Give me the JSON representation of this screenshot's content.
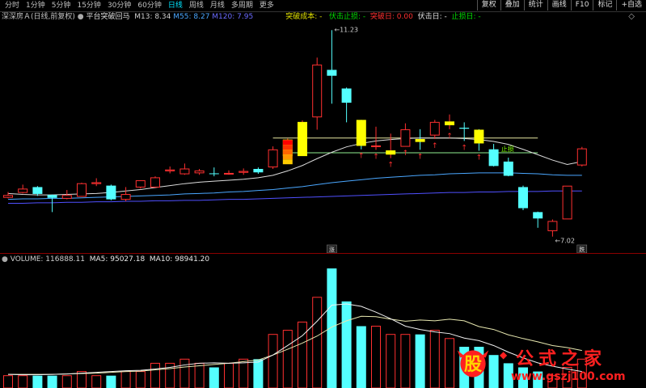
{
  "toolbar": {
    "tabs": [
      "分时",
      "1分钟",
      "5分钟",
      "15分钟",
      "30分钟",
      "60分钟",
      "日线",
      "周线",
      "月线",
      "多周期",
      "更多"
    ],
    "active_tab": 6,
    "right_buttons": [
      "复权",
      "叠加",
      "统计",
      "画线",
      "F10",
      "标记",
      "+自选"
    ]
  },
  "info": {
    "stock": "深深房Ａ(日线,前复权)",
    "indicator": "平台突破回马",
    "m13": "M13: 8.34",
    "m55": "M55: 8.27",
    "m120": "M120: 7.95",
    "breakout_cost": "突破成本: -",
    "ambush_stop": "伏击止损: -",
    "breakout_day": "突破日: 0.00",
    "ambush_day": "伏击日: -",
    "stop_day": "止损日: -",
    "close_symbol": "◇"
  },
  "annotations": {
    "high_label": "←11.23",
    "low_label": "←7.02",
    "stop_label": "止损",
    "marker_up": "涨",
    "marker_down": "跌"
  },
  "volume": {
    "label": "VOLUME: 116888.11",
    "ma5": "MA5: 95027.18",
    "ma10": "MA10: 98941.20"
  },
  "watermark": {
    "logo_char": "股",
    "title": "公式之家",
    "url": "www.gszj100.com"
  },
  "colors": {
    "up": "#ff3030",
    "down": "#54ffff",
    "ma13": "#dcdcdc",
    "ma55": "#4aa7ff",
    "ma120": "#5050ff",
    "platform": "#e6e6a0",
    "support": "#90ee90",
    "highlight": "#ffff00"
  },
  "chart_data": {
    "type": "candlestick",
    "candles": [
      {
        "o": 7.82,
        "c": 7.86,
        "h": 7.93,
        "l": 7.8
      },
      {
        "o": 7.92,
        "c": 7.99,
        "h": 8.08,
        "l": 7.9
      },
      {
        "o": 8.03,
        "c": 7.89,
        "h": 8.05,
        "l": 7.85
      },
      {
        "o": 7.87,
        "c": 7.81,
        "h": 7.88,
        "l": 7.52
      },
      {
        "o": 7.8,
        "c": 7.86,
        "h": 7.97,
        "l": 7.78
      },
      {
        "o": 7.84,
        "c": 8.1,
        "h": 8.12,
        "l": 7.84
      },
      {
        "o": 8.1,
        "c": 8.12,
        "h": 8.21,
        "l": 8.05
      },
      {
        "o": 8.06,
        "c": 7.78,
        "h": 8.08,
        "l": 7.76
      },
      {
        "o": 7.78,
        "c": 7.88,
        "h": 8.03,
        "l": 7.74
      },
      {
        "o": 8.03,
        "c": 8.16,
        "h": 8.16,
        "l": 8.0
      },
      {
        "o": 8.03,
        "c": 8.22,
        "h": 8.25,
        "l": 8.02
      },
      {
        "o": 8.36,
        "c": 8.38,
        "h": 8.45,
        "l": 8.31
      },
      {
        "o": 8.3,
        "c": 8.4,
        "h": 8.51,
        "l": 8.28
      },
      {
        "o": 8.32,
        "c": 8.36,
        "h": 8.4,
        "l": 8.28
      },
      {
        "o": 8.31,
        "c": 8.3,
        "h": 8.43,
        "l": 8.25
      },
      {
        "o": 8.3,
        "c": 8.31,
        "h": 8.37,
        "l": 8.28
      },
      {
        "o": 8.33,
        "c": 8.35,
        "h": 8.41,
        "l": 8.28
      },
      {
        "o": 8.4,
        "c": 8.33,
        "h": 8.43,
        "l": 8.3
      },
      {
        "o": 8.44,
        "c": 8.79,
        "h": 8.86,
        "l": 8.4
      },
      {
        "o": 8.67,
        "c": 8.99,
        "h": 9.02,
        "l": 8.67
      },
      {
        "o": 8.67,
        "c": 9.35,
        "h": 9.39,
        "l": 8.67
      },
      {
        "o": 9.46,
        "c": 10.52,
        "h": 10.67,
        "l": 9.2
      },
      {
        "o": 10.42,
        "c": 10.3,
        "h": 11.23,
        "l": 9.73
      },
      {
        "o": 10.04,
        "c": 9.75,
        "h": 10.06,
        "l": 9.35
      },
      {
        "o": 9.4,
        "c": 8.87,
        "h": 9.4,
        "l": 8.8
      },
      {
        "o": 8.87,
        "c": 8.87,
        "h": 9.26,
        "l": 8.79
      },
      {
        "o": 8.7,
        "c": 8.77,
        "h": 9.12,
        "l": 8.62
      },
      {
        "o": 8.86,
        "c": 9.2,
        "h": 9.33,
        "l": 8.86
      },
      {
        "o": 9.01,
        "c": 8.95,
        "h": 9.21,
        "l": 8.79
      },
      {
        "o": 9.09,
        "c": 9.35,
        "h": 9.4,
        "l": 9.01
      },
      {
        "o": 9.3,
        "c": 9.36,
        "h": 9.51,
        "l": 9.21
      },
      {
        "o": 9.24,
        "c": 9.22,
        "h": 9.35,
        "l": 8.97
      },
      {
        "o": 9.2,
        "c": 8.92,
        "h": 9.21,
        "l": 8.77
      },
      {
        "o": 8.8,
        "c": 8.46,
        "h": 8.91,
        "l": 8.45
      },
      {
        "o": 8.55,
        "c": 8.26,
        "h": 8.63,
        "l": 8.25
      },
      {
        "o": 8.03,
        "c": 7.6,
        "h": 8.06,
        "l": 7.56
      },
      {
        "o": 7.52,
        "c": 7.39,
        "h": 7.53,
        "l": 7.2
      },
      {
        "o": 7.14,
        "c": 7.33,
        "h": 7.37,
        "l": 7.02
      },
      {
        "o": 7.38,
        "c": 8.05,
        "h": 8.05,
        "l": 7.38
      },
      {
        "o": 8.48,
        "c": 8.81,
        "h": 8.85,
        "l": 8.45
      }
    ],
    "ma13": [
      7.9,
      7.88,
      7.87,
      7.87,
      7.88,
      7.89,
      7.9,
      7.92,
      7.95,
      7.98,
      8.02,
      8.06,
      8.1,
      8.13,
      8.15,
      8.17,
      8.19,
      8.22,
      8.27,
      8.36,
      8.47,
      8.61,
      8.74,
      8.85,
      8.92,
      8.97,
      9.0,
      9.02,
      9.03,
      9.03,
      9.03,
      9.02,
      9.0,
      8.96,
      8.9,
      8.8,
      8.69,
      8.58,
      8.49,
      8.55
    ],
    "ma55": [
      7.78,
      7.79,
      7.79,
      7.8,
      7.8,
      7.81,
      7.82,
      7.83,
      7.84,
      7.85,
      7.86,
      7.87,
      7.89,
      7.9,
      7.91,
      7.93,
      7.94,
      7.96,
      7.98,
      8.01,
      8.04,
      8.08,
      8.12,
      8.15,
      8.18,
      8.21,
      8.23,
      8.25,
      8.27,
      8.28,
      8.3,
      8.31,
      8.32,
      8.32,
      8.32,
      8.31,
      8.3,
      8.28,
      8.27,
      8.27
    ],
    "ma120": [
      7.7,
      7.7,
      7.71,
      7.71,
      7.72,
      7.72,
      7.73,
      7.73,
      7.74,
      7.74,
      7.75,
      7.75,
      7.76,
      7.76,
      7.77,
      7.78,
      7.78,
      7.79,
      7.8,
      7.81,
      7.82,
      7.83,
      7.84,
      7.85,
      7.86,
      7.87,
      7.88,
      7.89,
      7.9,
      7.91,
      7.92,
      7.92,
      7.93,
      7.93,
      7.94,
      7.94,
      7.94,
      7.95,
      7.95,
      7.95
    ],
    "platform_level": 9.03,
    "support_level": 8.73,
    "volume_values": [
      3,
      3,
      3,
      3,
      3,
      4,
      3,
      3,
      4,
      4,
      6,
      6,
      7,
      6,
      5,
      6,
      7,
      7,
      13,
      14,
      16,
      22,
      29,
      21,
      15,
      15,
      13,
      13,
      13,
      14,
      12,
      10,
      10,
      8,
      6,
      5,
      4,
      3,
      5,
      7
    ],
    "volume_ma5": [
      3.3,
      3.2,
      3.2,
      3.3,
      3.4,
      3.6,
      3.8,
      4.0,
      4.2,
      4.3,
      4.6,
      5.0,
      5.6,
      6.0,
      6.1,
      6.0,
      6.1,
      6.3,
      8.0,
      10.3,
      12.7,
      16.2,
      20.1,
      20.4,
      19.8,
      18.4,
      16.8,
      15.0,
      14.2,
      13.6,
      13.2,
      12.1,
      11.5,
      10.3,
      8.7,
      7.3,
      6.1,
      5.3,
      4.6,
      4.0
    ],
    "volume_ma10": [
      3.3,
      3.3,
      3.3,
      3.3,
      3.4,
      3.5,
      3.6,
      3.8,
      4.0,
      4.1,
      4.4,
      4.7,
      5.1,
      5.4,
      5.7,
      6.0,
      6.4,
      6.8,
      8.0,
      9.4,
      10.9,
      12.6,
      14.8,
      16.3,
      17.4,
      17.3,
      16.7,
      16.2,
      16.5,
      16.3,
      16.7,
      16.3,
      14.9,
      14.2,
      12.9,
      12.0,
      11.2,
      10.3,
      9.8,
      9.1
    ],
    "volume_ymax": 30,
    "price_ylim": [
      6.9,
      11.35
    ],
    "breakout_arrow_days": [
      24,
      25,
      26,
      27,
      28,
      29,
      30,
      31,
      32
    ],
    "highlight_days": [
      19,
      20,
      24,
      26,
      28,
      30,
      32
    ]
  }
}
